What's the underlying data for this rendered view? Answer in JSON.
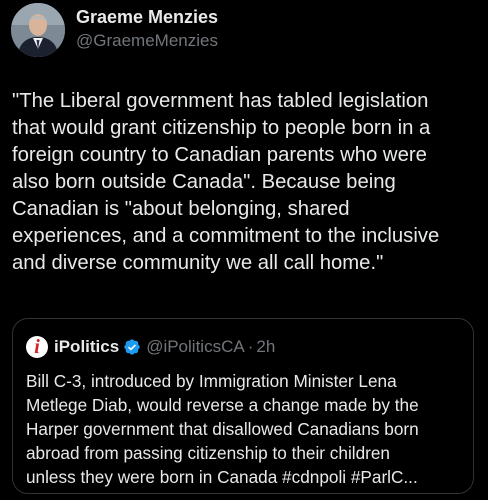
{
  "author": {
    "display_name": "Graeme Menzies",
    "handle": "@GraemeMenzies",
    "avatar_icon": "profile-photo"
  },
  "tweet": {
    "text": "\"The Liberal government has tabled legislation\nthat would grant citizenship to people born in a\nforeign country to Canadian parents who were\nalso born outside Canada\". Because being\nCanadian is \"about belonging, shared\nexperiences, and a commitment to the inclusive\nand diverse community we all call home.\""
  },
  "quoted_tweet": {
    "logo_letter": "i",
    "display_name": "iPolitics",
    "verified_icon": "verified-badge-icon",
    "handle": "@iPoliticsCA",
    "separator": "·",
    "time": "2h",
    "text": "Bill C-3, introduced by Immigration Minister Lena\nMetlege Diab, would reverse a change made by the\nHarper government that disallowed Canadians born\nabroad from passing citizenship to their children\nunless they were born in Canada #cdnpoli #ParlC..."
  },
  "colors": {
    "background": "#000000",
    "text_primary": "#e7e9ea",
    "text_secondary": "#71767b",
    "border": "#2f3336",
    "verified": "#1d9bf0",
    "ipolitics_red": "#d3202a"
  }
}
